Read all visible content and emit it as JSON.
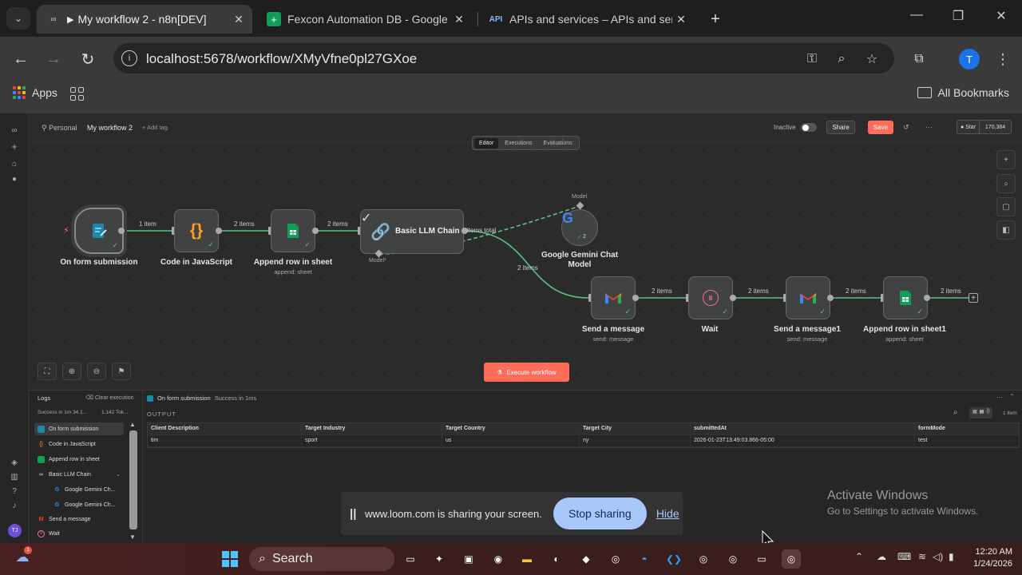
{
  "browser": {
    "tabs": [
      {
        "title": "My workflow 2 - n8n[DEV]",
        "active": true
      },
      {
        "title": "Fexcon Automation DB - Google S",
        "active": false
      },
      {
        "title": "APIs and services – APIs and servic",
        "active": false
      }
    ],
    "url": "localhost:5678/workflow/XMyVfne0pl27GXoe",
    "profile_initial": "T",
    "bookmarks": {
      "apps": "Apps",
      "all": "All Bookmarks"
    }
  },
  "n8n": {
    "breadcrumb": {
      "owner": "Personal",
      "workflow": "My workflow 2",
      "add_tag": "+ Add tag"
    },
    "status": "Inactive",
    "share": "Share",
    "save": "Save",
    "github": {
      "label": "Star",
      "count": "170,384"
    },
    "mode_tabs": [
      "Editor",
      "Executions",
      "Evaluations"
    ],
    "nodes": {
      "trigger": {
        "label": "On form submission"
      },
      "code": {
        "label": "Code in JavaScript"
      },
      "append": {
        "label": "Append row in sheet",
        "sub": "append: sheet"
      },
      "llm": {
        "label": "Basic LLM Chain",
        "model_port": "Model*"
      },
      "gemini": {
        "label_line1": "Google Gemini Chat",
        "label_line2": "Model",
        "port_label": "Model",
        "badge": "2"
      },
      "send1": {
        "label": "Send a message",
        "sub": "send: message"
      },
      "wait": {
        "label": "Wait"
      },
      "send2": {
        "label": "Send a message1",
        "sub": "send: message"
      },
      "append2": {
        "label": "Append row in sheet1",
        "sub": "append: sheet"
      }
    },
    "edges": {
      "e1": "1 item",
      "e2": "2 items",
      "e3": "2 items",
      "e4": "items total",
      "e5": "2 items",
      "e6": "2 items",
      "e7": "2 items",
      "e8": "2 items",
      "e9": "2 items"
    },
    "execute": "Execute workflow",
    "logs": {
      "title": "Logs",
      "clear": "Clear execution",
      "success": "Success in 1m 34.1...",
      "tokens": "1,142 Tok...",
      "items": [
        {
          "label": "On form submission",
          "active": true
        },
        {
          "label": "Code in JavaScript"
        },
        {
          "label": "Append row in sheet"
        },
        {
          "label": "Basic LLM Chain"
        },
        {
          "label": "Google Gemini Ch...",
          "child": true
        },
        {
          "label": "Google Gemini Ch...",
          "child": true
        },
        {
          "label": "Send a message"
        },
        {
          "label": "Wait"
        }
      ],
      "selected_node": "On form submission",
      "selected_status": "Success in 1ms",
      "output_label": "OUTPUT",
      "item_count": "1 item",
      "table": {
        "columns": [
          "Client Description",
          "Target Industry",
          "Target Country",
          "Target City",
          "submittedAt",
          "formMode"
        ],
        "rows": [
          [
            "tim",
            "sport",
            "us",
            "ny",
            "2026-01-23T13:49:03.866-05:00",
            "test"
          ]
        ]
      }
    }
  },
  "loom": {
    "message": "www.loom.com is sharing your screen.",
    "stop": "Stop sharing",
    "hide": "Hide"
  },
  "watermark": {
    "line1": "Activate Windows",
    "line2": "Go to Settings to activate Windows."
  },
  "taskbar": {
    "search": "Search",
    "time": "12:20 AM",
    "date": "1/24/2026"
  },
  "colors": {
    "accent": "#ff6d5a",
    "edge": "#5bc283"
  }
}
